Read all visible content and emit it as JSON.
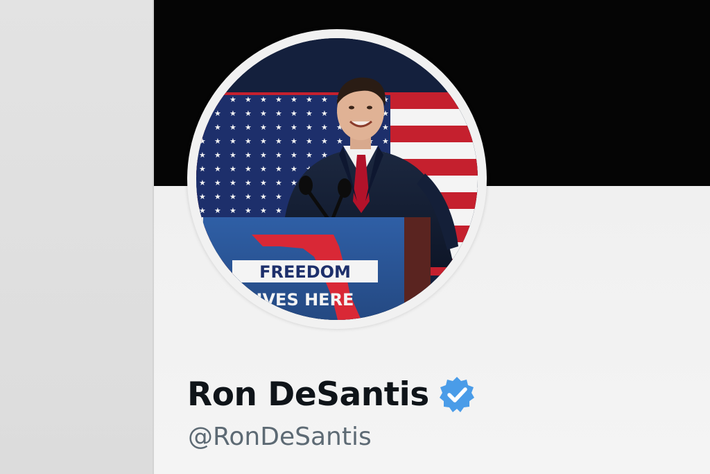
{
  "profile": {
    "display_name": "Ron DeSantis",
    "handle": "@RonDeSantis",
    "verified": true,
    "verified_badge_color": "#4a9ce8",
    "banner_color": "#050505"
  },
  "avatar_photo": {
    "podium_sign_line1": "FREEDOM",
    "podium_sign_line2": "IVES HERE",
    "flag_colors": {
      "blue": "#1d2f6b",
      "red": "#c5202e",
      "white": "#f4f4f4"
    }
  }
}
